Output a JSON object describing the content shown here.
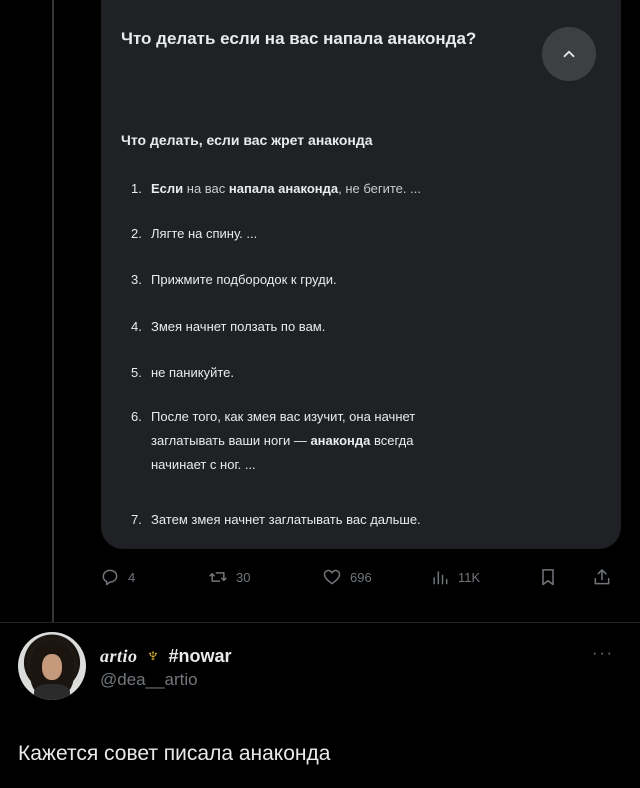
{
  "card": {
    "question": "Что делать если на вас напала анаконда?",
    "answer_title": "Что делать, если вас жрет анаконда",
    "steps": [
      {
        "num": "1.",
        "b1": "Если",
        "t1": " на вас ",
        "b2": "напала анаконда",
        "t2": ", не бегите. ..."
      },
      {
        "num": "2.",
        "text": "Лягте на спину. ..."
      },
      {
        "num": "3.",
        "text": "Прижмите подбородок к груди."
      },
      {
        "num": "4.",
        "text": "Змея начнет ползать по вам."
      },
      {
        "num": "5.",
        "text": "не паникуйте."
      },
      {
        "num": "6.",
        "line1": "После того, как змея вас изучит, она начнет",
        "pre": "заглатывать ваши ноги — ",
        "bold": "анаконда",
        "post": " всегда",
        "line3": "начинает с ног. ..."
      },
      {
        "num": "7.",
        "text": "Затем змея начнет заглатывать вас дальше."
      }
    ]
  },
  "actions": {
    "replies": "4",
    "reposts": "30",
    "likes": "696",
    "views": "11K"
  },
  "reply": {
    "name_script": "artio",
    "name_tag": "#nowar",
    "handle": "@dea__artio",
    "more": "···",
    "text": "Кажется совет писала анаконда"
  },
  "icons": {
    "collapse": "chevron-up-icon",
    "reply": "reply-icon",
    "repost": "repost-icon",
    "like": "heart-icon",
    "views": "views-icon",
    "bookmark": "bookmark-icon",
    "share": "share-icon",
    "trident": "trident-icon"
  },
  "colors": {
    "background": "#000000",
    "card": "#202124",
    "muted": "#71767b",
    "trident": "#f4c430"
  }
}
